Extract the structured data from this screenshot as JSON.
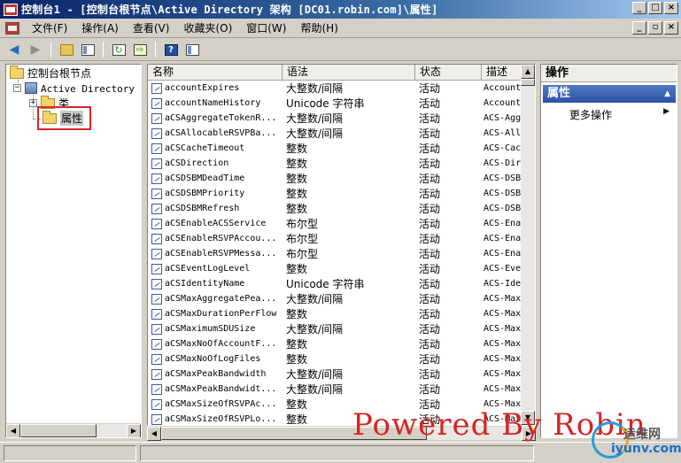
{
  "window": {
    "title": "控制台1 - [控制台根节点\\Active Directory 架构 [DC01.robin.com]\\属性]",
    "controls": [
      "_",
      "□",
      "×"
    ]
  },
  "menu": {
    "items": [
      "文件(F)",
      "操作(A)",
      "查看(V)",
      "收藏夹(O)",
      "窗口(W)",
      "帮助(H)"
    ],
    "mdi_controls": [
      "_",
      "▫",
      "×"
    ]
  },
  "toolbar": {
    "icons": [
      "back-icon",
      "forward-icon",
      "up-folder-icon",
      "show-hide-tree-icon",
      "refresh-icon",
      "export-list-icon",
      "help-icon",
      "properties-pane-icon"
    ]
  },
  "tree": {
    "root": "控制台根节点",
    "ad_node": "Active Directory 架",
    "classes": "类",
    "attributes": "属性"
  },
  "list": {
    "columns": [
      "名称",
      "语法",
      "状态",
      "描述"
    ],
    "rows": [
      {
        "name": "accountExpires",
        "syntax": "大整数/间隔",
        "status": "活动",
        "desc": "Account-"
      },
      {
        "name": "accountNameHistory",
        "syntax": "Unicode 字符串",
        "status": "活动",
        "desc": "Account-"
      },
      {
        "name": "aCSAggregateTokenR...",
        "syntax": "大整数/间隔",
        "status": "活动",
        "desc": "ACS-Aggr"
      },
      {
        "name": "aCSAllocableRSVPBa...",
        "syntax": "大整数/间隔",
        "status": "活动",
        "desc": "ACS-Allo"
      },
      {
        "name": "aCSCacheTimeout",
        "syntax": "整数",
        "status": "活动",
        "desc": "ACS-Cach"
      },
      {
        "name": "aCSDirection",
        "syntax": "整数",
        "status": "活动",
        "desc": "ACS-Dire"
      },
      {
        "name": "aCSDSBMDeadTime",
        "syntax": "整数",
        "status": "活动",
        "desc": "ACS-DSBM"
      },
      {
        "name": "aCSDSBMPriority",
        "syntax": "整数",
        "status": "活动",
        "desc": "ACS-DSBM"
      },
      {
        "name": "aCSDSBMRefresh",
        "syntax": "整数",
        "status": "活动",
        "desc": "ACS-DSBM"
      },
      {
        "name": "aCSEnableACSService",
        "syntax": "布尔型",
        "status": "活动",
        "desc": "ACS-Enab"
      },
      {
        "name": "aCSEnableRSVPAccou...",
        "syntax": "布尔型",
        "status": "活动",
        "desc": "ACS-Enab"
      },
      {
        "name": "aCSEnableRSVPMessa...",
        "syntax": "布尔型",
        "status": "活动",
        "desc": "ACS-Enab"
      },
      {
        "name": "aCSEventLogLevel",
        "syntax": "整数",
        "status": "活动",
        "desc": "ACS-Even"
      },
      {
        "name": "aCSIdentityName",
        "syntax": "Unicode 字符串",
        "status": "活动",
        "desc": "ACS-Iden"
      },
      {
        "name": "aCSMaxAggregatePea...",
        "syntax": "大整数/间隔",
        "status": "活动",
        "desc": "ACS-Max-"
      },
      {
        "name": "aCSMaxDurationPerFlow",
        "syntax": "整数",
        "status": "活动",
        "desc": "ACS-Max-"
      },
      {
        "name": "aCSMaximumSDUSize",
        "syntax": "大整数/间隔",
        "status": "活动",
        "desc": "ACS-Max-"
      },
      {
        "name": "aCSMaxNoOfAccountF...",
        "syntax": "整数",
        "status": "活动",
        "desc": "ACS-Max-"
      },
      {
        "name": "aCSMaxNoOfLogFiles",
        "syntax": "整数",
        "status": "活动",
        "desc": "ACS-Max-"
      },
      {
        "name": "aCSMaxPeakBandwidth",
        "syntax": "大整数/间隔",
        "status": "活动",
        "desc": "ACS-Max-"
      },
      {
        "name": "aCSMaxPeakBandwidt...",
        "syntax": "大整数/间隔",
        "status": "活动",
        "desc": "ACS-Max-"
      },
      {
        "name": "aCSMaxSizeOfRSVPAc...",
        "syntax": "整数",
        "status": "活动",
        "desc": "ACS-Max-"
      },
      {
        "name": "aCSMaxSizeOfRSVPLo...",
        "syntax": "整数",
        "status": "活动",
        "desc": "ACS-Max-"
      }
    ]
  },
  "actions": {
    "header": "操作",
    "section": "属性",
    "more": "更多操作"
  },
  "watermark": {
    "text": "Powered By Robin",
    "logo_name": "运维网",
    "logo_url": "iyunv.com"
  }
}
